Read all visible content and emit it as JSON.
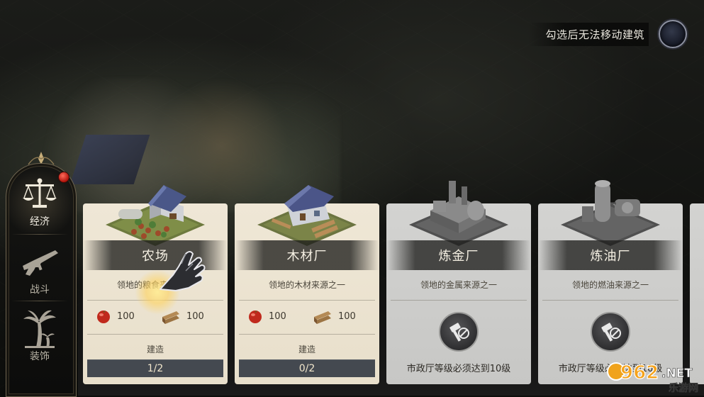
{
  "top_toggle": {
    "label": "勾选后无法移动建筑",
    "checked": false
  },
  "categories": [
    {
      "label": "经济",
      "icon": "scales-icon",
      "active": true,
      "has_notification": true
    },
    {
      "label": "战斗",
      "icon": "rifle-icon",
      "active": false
    },
    {
      "label": "装饰",
      "icon": "palm-tree-icon",
      "active": false
    }
  ],
  "buildings": [
    {
      "name": "农场",
      "description": "领地的粮食来源之一",
      "icon": "farm-building",
      "unlocked": true,
      "costs": [
        {
          "resource": "food-icon",
          "amount": "100"
        },
        {
          "resource": "wood-icon",
          "amount": "100"
        }
      ],
      "build_label": "建造",
      "build_count": "1/2"
    },
    {
      "name": "木材厂",
      "description": "领地的木材来源之一",
      "icon": "sawmill-building",
      "unlocked": true,
      "costs": [
        {
          "resource": "food-icon",
          "amount": "100"
        },
        {
          "resource": "wood-icon",
          "amount": "100"
        }
      ],
      "build_label": "建造",
      "build_count": "0/2"
    },
    {
      "name": "炼金厂",
      "description": "领地的金属来源之一",
      "icon": "foundry-building",
      "unlocked": false,
      "requirement": "市政厅等级必须达到10级"
    },
    {
      "name": "炼油厂",
      "description": "领地的燃油来源之一",
      "icon": "refinery-building",
      "unlocked": false,
      "requirement": "市政厅等级必须达到10级"
    }
  ],
  "watermark": {
    "number": "962",
    "suffix": ".NET",
    "site": "乐游网"
  }
}
